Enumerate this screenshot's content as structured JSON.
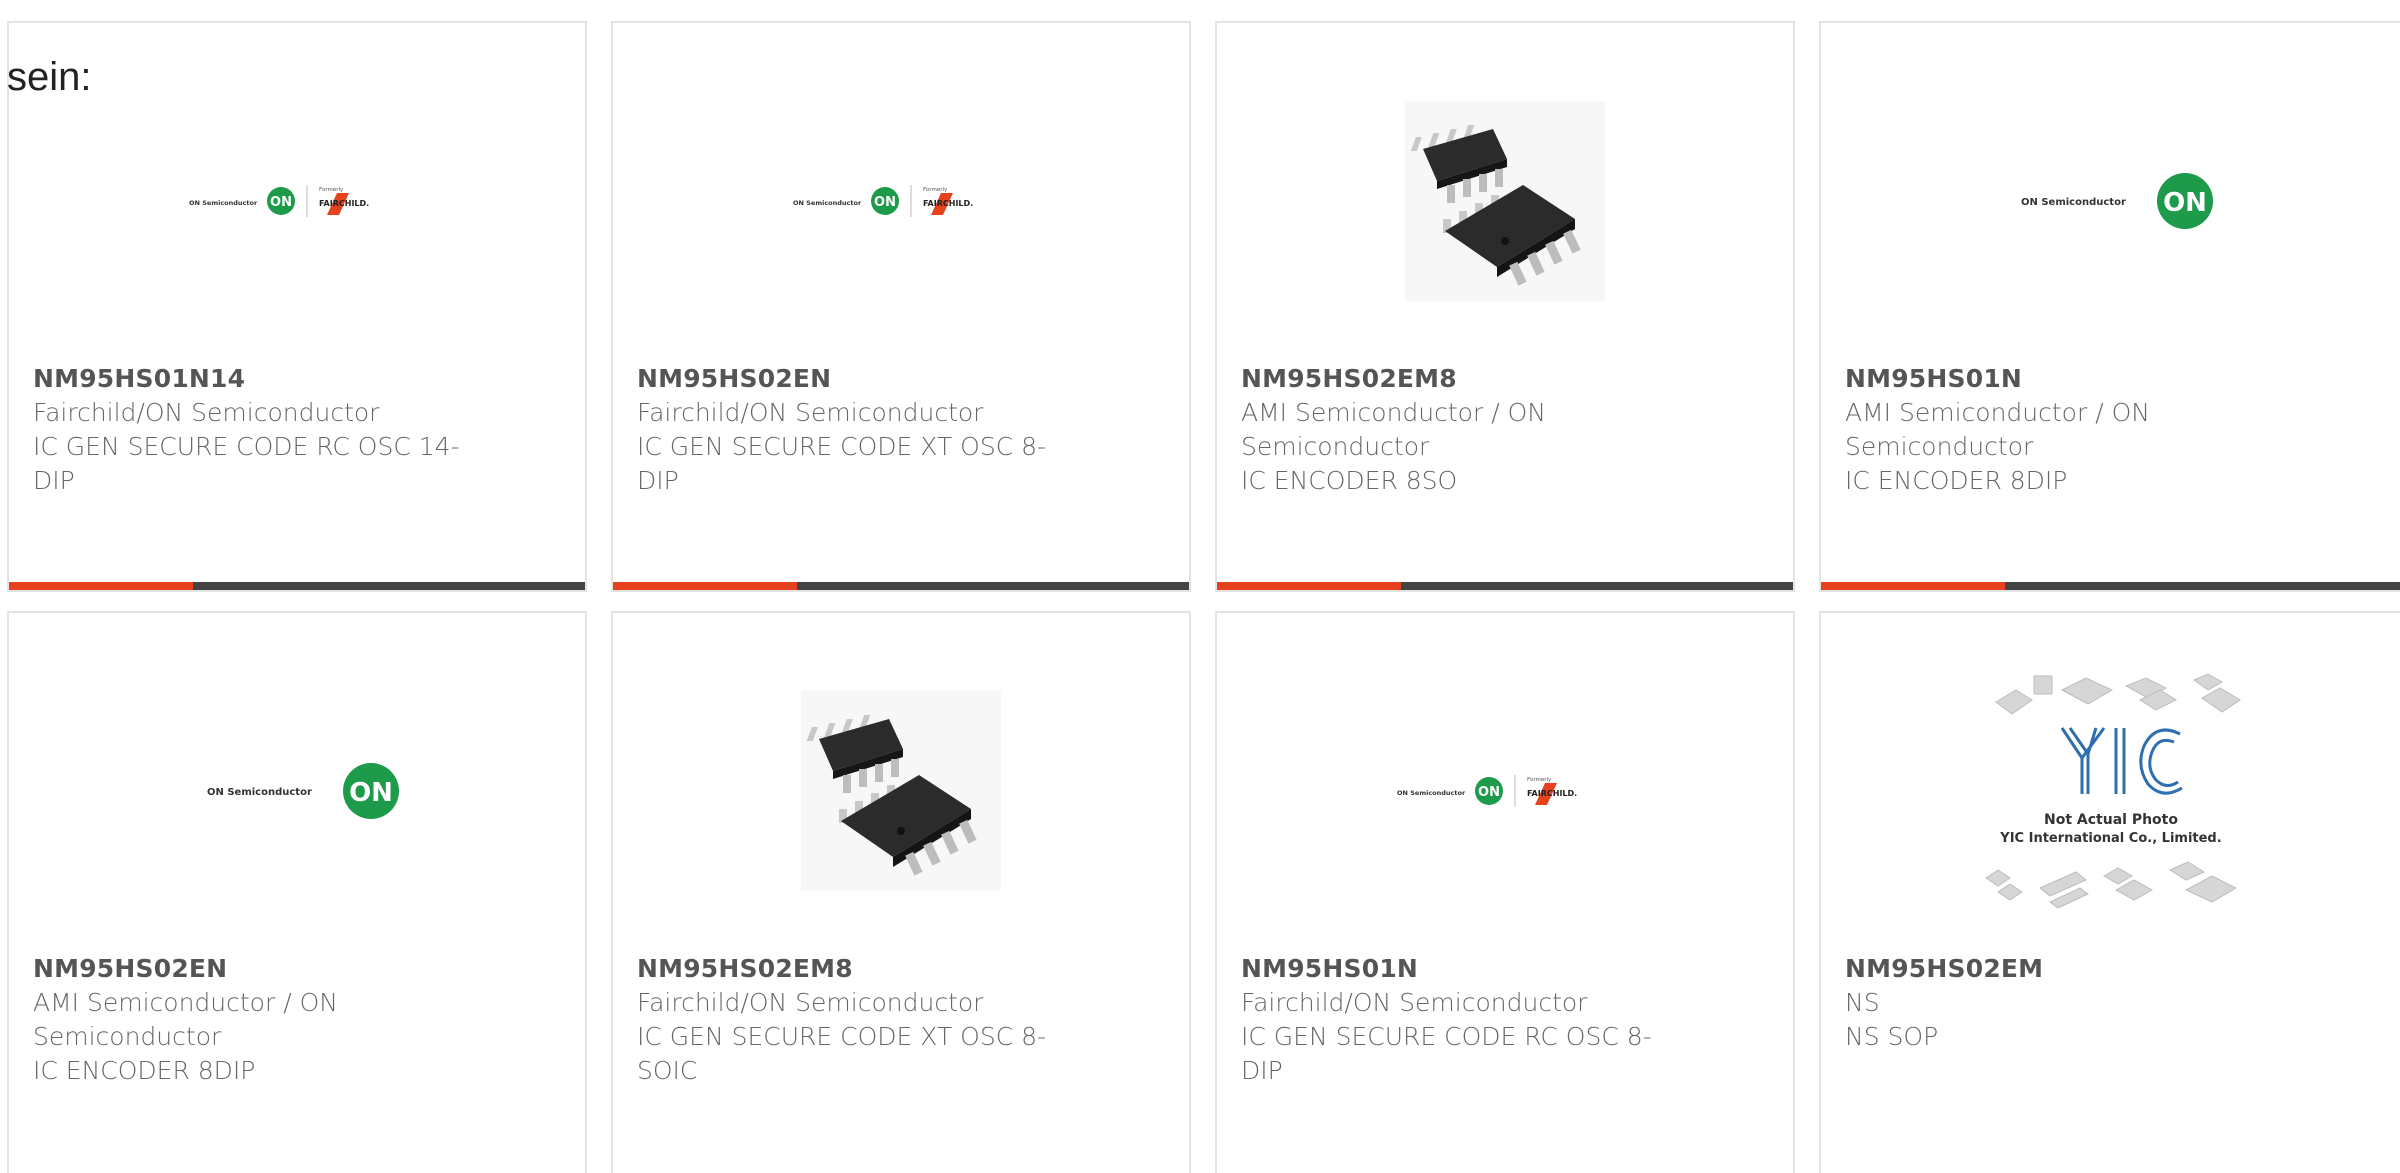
{
  "page_label": "sein:",
  "colors": {
    "accent": "#e5421d",
    "bar": "#444444",
    "text": "#666666",
    "on_green": "#1e9a4b"
  },
  "cards": [
    {
      "part": "NM95HS01N14",
      "maker": "Fairchild/ON Semiconductor",
      "desc": "IC GEN SECURE CODE RC OSC 14-DIP",
      "image": "on-fairchild-logo",
      "logo_on_text": "ON Semiconductor",
      "logo_formerly": "Formerly",
      "logo_fairchild": "FAIRCHILD."
    },
    {
      "part": "NM95HS02EN",
      "maker": "Fairchild/ON Semiconductor",
      "desc": "IC GEN SECURE CODE XT OSC 8-DIP",
      "image": "on-fairchild-logo",
      "logo_on_text": "ON Semiconductor",
      "logo_formerly": "Formerly",
      "logo_fairchild": "FAIRCHILD."
    },
    {
      "part": "NM95HS02EM8",
      "maker": "AMI Semiconductor / ON Semiconductor",
      "desc": "IC ENCODER 8SO",
      "image": "soic-chip-photo"
    },
    {
      "part": "NM95HS01N",
      "maker": "AMI Semiconductor / ON Semiconductor",
      "desc": "IC ENCODER 8DIP",
      "image": "on-logo",
      "logo_on_text": "ON Semiconductor"
    },
    {
      "part": "NM95HS02EN",
      "maker": "AMI Semiconductor / ON Semiconductor",
      "desc": "IC ENCODER 8DIP",
      "image": "on-logo",
      "logo_on_text": "ON Semiconductor"
    },
    {
      "part": "NM95HS02EM8",
      "maker": "Fairchild/ON Semiconductor",
      "desc": "IC GEN SECURE CODE XT OSC 8-SOIC",
      "image": "soic-chip-photo"
    },
    {
      "part": "NM95HS01N",
      "maker": "Fairchild/ON Semiconductor",
      "desc": "IC GEN SECURE CODE RC OSC 8-DIP",
      "image": "on-fairchild-logo",
      "logo_on_text": "ON Semiconductor",
      "logo_formerly": "Formerly",
      "logo_fairchild": "FAIRCHILD."
    },
    {
      "part": "NM95HS02EM",
      "maker": "NS",
      "desc": "NS SOP",
      "image": "yic-placeholder",
      "placeholder_line1": "Not Actual Photo",
      "placeholder_line2": "YIC International Co., Limited."
    }
  ]
}
